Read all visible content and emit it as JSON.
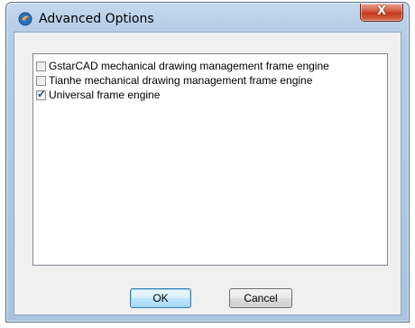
{
  "window": {
    "title": "Advanced Options",
    "close_label": "X"
  },
  "list": {
    "items": [
      {
        "label": "GstarCAD mechanical drawing management frame engine",
        "checked": false
      },
      {
        "label": "Tianhe mechanical drawing management frame engine",
        "checked": false
      },
      {
        "label": "Universal frame engine",
        "checked": true
      }
    ]
  },
  "buttons": {
    "ok_label": "OK",
    "cancel_label": "Cancel"
  },
  "colors": {
    "titlebar": "#b6cde6",
    "close_button": "#c2371c",
    "client_background": "#f0f0f0"
  },
  "icons": {
    "title_icon": "app-icon",
    "check_mark": "check-icon"
  }
}
